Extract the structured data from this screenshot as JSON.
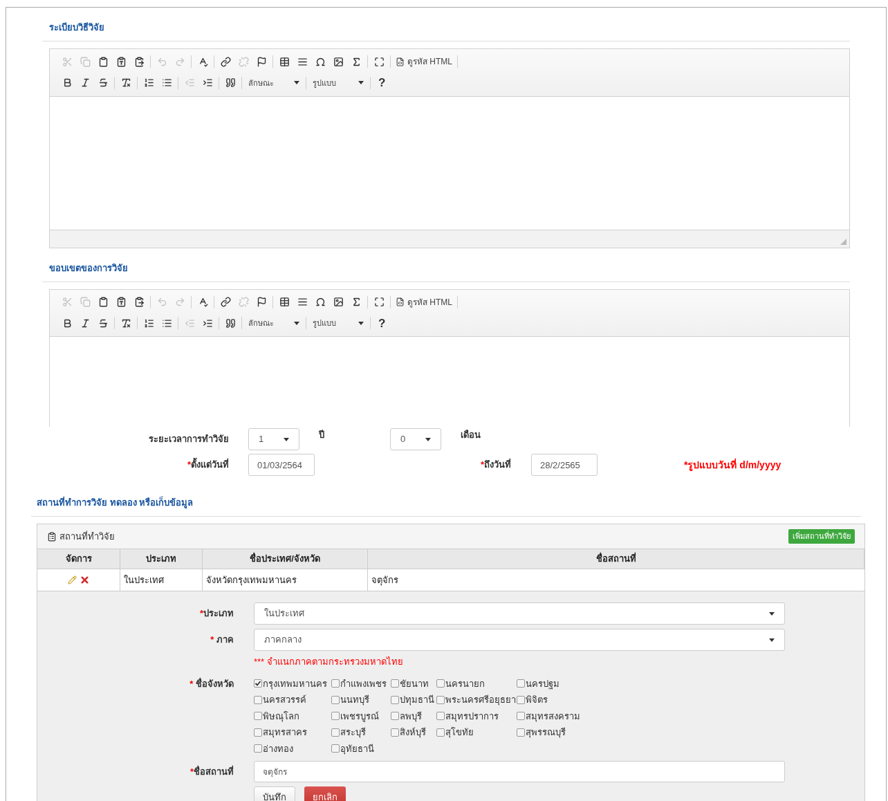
{
  "editors": [
    {
      "title": "ระเบียบวิธีวิจัย",
      "source_label": "ดูรหัส HTML",
      "styles_label": "ลักษณะ",
      "format_label": "รูปแบบ",
      "help": "?",
      "tools": [
        {
          "disabled": true
        },
        {
          "disabled": true
        },
        {
          "disabled": false
        },
        {
          "disabled": false
        },
        {
          "disabled": false
        },
        {
          "disabled": true
        },
        {
          "disabled": true
        },
        {
          "disabled": false
        },
        {
          "disabled": false
        },
        {
          "disabled": true
        },
        {
          "disabled": false
        },
        {
          "disabled": false
        },
        {
          "disabled": false
        },
        {
          "disabled": false
        },
        {
          "disabled": false
        },
        {
          "disabled": false
        },
        {
          "disabled": false
        },
        {
          "disabled": false
        },
        {
          "disabled": false
        },
        {
          "disabled": false
        },
        {
          "disabled": false
        },
        {
          "disabled": false
        },
        {
          "disabled": false
        },
        {
          "disabled": true
        },
        {
          "disabled": false
        },
        {
          "disabled": false
        }
      ]
    },
    {
      "title": "ขอบเขตของการวิจัย",
      "source_label": "ดูรหัส HTML",
      "styles_label": "ลักษณะ",
      "format_label": "รูปแบบ",
      "help": "?",
      "tools": [
        {
          "disabled": true
        },
        {
          "disabled": true
        },
        {
          "disabled": false
        },
        {
          "disabled": false
        },
        {
          "disabled": false
        },
        {
          "disabled": true
        },
        {
          "disabled": true
        },
        {
          "disabled": false
        },
        {
          "disabled": false
        },
        {
          "disabled": true
        },
        {
          "disabled": false
        },
        {
          "disabled": false
        },
        {
          "disabled": false
        },
        {
          "disabled": false
        },
        {
          "disabled": false
        },
        {
          "disabled": false
        },
        {
          "disabled": false
        },
        {
          "disabled": false
        },
        {
          "disabled": false
        },
        {
          "disabled": false
        },
        {
          "disabled": false
        },
        {
          "disabled": false
        },
        {
          "disabled": false
        },
        {
          "disabled": true
        },
        {
          "disabled": false
        },
        {
          "disabled": false
        }
      ]
    }
  ],
  "duration": {
    "label": "ระยะเวลาการทำวิจัย",
    "years": "1",
    "years_unit": "ปี",
    "months": "0",
    "months_unit": "เดือน"
  },
  "dates": {
    "from_label": "ตั้งแต่วันที่",
    "from": "01/03/2564",
    "to_label": "ถึงวันที่",
    "to": "28/2/2565",
    "required_mark": "*",
    "format_note": "*รูปแบบวันที่ d/m/yyyy"
  },
  "location": {
    "title": "สถานที่ทำการวิจัย ทดลอง หรือเก็บข้อมูล",
    "panel_title": "สถานที่ทำวิจัย",
    "add_button": "เพิ่มสถานที่ทำวิจัย",
    "columns": [
      "จัดการ",
      "ประเภท",
      "ชื่อประเทศ/จังหวัด",
      "ชื่อสถานที่"
    ],
    "rows": [
      {
        "type": "ในประเทศ",
        "province": "จังหวัดกรุงเทพมหานคร",
        "place": "จตุจักร"
      }
    ]
  },
  "location_form": {
    "type_label": "ประเภท",
    "type_value": "ในประเทศ",
    "region_label": " ภาค",
    "region_value": "ภาคกลาง",
    "region_note": "*** จำแนกภาคตามกระทรวงมหาดไทย",
    "province_label": " ชื่อจังหวัด",
    "required_mark": "*",
    "provinces": [
      {
        "name": "กรุงเทพมหานคร",
        "checked": true
      },
      {
        "name": "กำแพงเพชร",
        "checked": false
      },
      {
        "name": "ชัยนาท",
        "checked": false
      },
      {
        "name": "นครนายก",
        "checked": false
      },
      {
        "name": "นครปฐม",
        "checked": false
      },
      {
        "name": "นครสวรรค์",
        "checked": false
      },
      {
        "name": "นนทบุรี",
        "checked": false
      },
      {
        "name": "ปทุมธานี",
        "checked": false
      },
      {
        "name": "พระนครศรีอยุธยา",
        "checked": false
      },
      {
        "name": "พิจิตร",
        "checked": false
      },
      {
        "name": "พิษณุโลก",
        "checked": false
      },
      {
        "name": "เพชรบูรณ์",
        "checked": false
      },
      {
        "name": "ลพบุรี",
        "checked": false
      },
      {
        "name": "สมุทรปราการ",
        "checked": false
      },
      {
        "name": "สมุทรสงคราม",
        "checked": false
      },
      {
        "name": "สมุทรสาคร",
        "checked": false
      },
      {
        "name": "สระบุรี",
        "checked": false
      },
      {
        "name": "สิงห์บุรี",
        "checked": false
      },
      {
        "name": "สุโขทัย",
        "checked": false
      },
      {
        "name": "สุพรรณบุรี",
        "checked": false
      },
      {
        "name": "อ่างทอง",
        "checked": false
      },
      {
        "name": "อุทัยธานี",
        "checked": false
      }
    ],
    "place_label": "ชื่อสถานที่",
    "place_value": "จตุจักร",
    "save_button": "บันทึก",
    "cancel_button": "ยกเลิก"
  }
}
